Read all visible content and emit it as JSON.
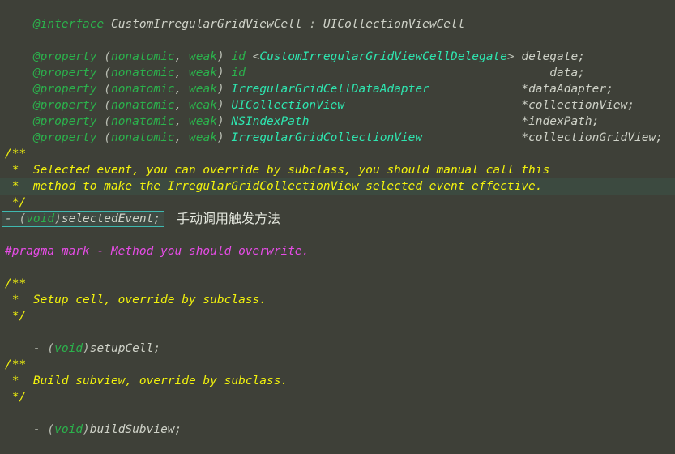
{
  "editor": {
    "background_color": "#3e4038",
    "highlight_band_color": "#3c4a40",
    "box_border_color": "#3fb9b0",
    "language": "Objective-C",
    "colors": {
      "keyword": "#2bb24c",
      "type": "#2ee6b0",
      "identifier": "#cfd2c8",
      "comment": "#f2f20d",
      "pragma": "#e64ce6",
      "punctuation": "#b9bdb2"
    }
  },
  "code": {
    "interface": {
      "keyword": "@interface",
      "class_name": " CustomIrregularGridViewCell",
      "separator": " : ",
      "superclass": "UICollectionViewCell"
    },
    "properties": [
      {
        "keyword": "@property",
        "open_paren": " (",
        "attribute_nonatomic": "nonatomic",
        "attribute_sep": ", ",
        "attribute_weak": "weak",
        "close_paren": ") ",
        "type_keyword": "id",
        "protocol_open": " <",
        "protocol": "CustomIrregularGridViewCellDelegate",
        "protocol_close": ">",
        "spacer": " ",
        "variable": "delegate;"
      },
      {
        "keyword": "@property",
        "open_paren": " (",
        "attribute_nonatomic": "nonatomic",
        "attribute_sep": ", ",
        "attribute_weak": "weak",
        "close_paren": ") ",
        "type_keyword": "id",
        "protocol_open": "",
        "protocol": "",
        "protocol_close": "",
        "spacer": "                                          ",
        "variable": " data;"
      },
      {
        "keyword": "@property",
        "open_paren": " (",
        "attribute_nonatomic": "nonatomic",
        "attribute_sep": ", ",
        "attribute_weak": "weak",
        "close_paren": ") ",
        "type_keyword": "",
        "protocol_open": "",
        "protocol": "IrregularGridCellDataAdapter",
        "protocol_close": "",
        "spacer": "             ",
        "variable": "*dataAdapter;"
      },
      {
        "keyword": "@property",
        "open_paren": " (",
        "attribute_nonatomic": "nonatomic",
        "attribute_sep": ", ",
        "attribute_weak": "weak",
        "close_paren": ") ",
        "type_keyword": "",
        "protocol_open": "",
        "protocol": "UICollectionView",
        "protocol_close": "",
        "spacer": "                         ",
        "variable": "*collectionView;"
      },
      {
        "keyword": "@property",
        "open_paren": " (",
        "attribute_nonatomic": "nonatomic",
        "attribute_sep": ", ",
        "attribute_weak": "weak",
        "close_paren": ") ",
        "type_keyword": "",
        "protocol_open": "",
        "protocol": "NSIndexPath",
        "protocol_close": "",
        "spacer": "                              ",
        "variable": "*indexPath;"
      },
      {
        "keyword": "@property",
        "open_paren": " (",
        "attribute_nonatomic": "nonatomic",
        "attribute_sep": ", ",
        "attribute_weak": "weak",
        "close_paren": ") ",
        "type_keyword": "",
        "protocol_open": "",
        "protocol": "IrregularGridCollectionView",
        "protocol_close": "",
        "spacer": "              ",
        "variable": "*collectionGridView;"
      }
    ],
    "selected_event_doc": {
      "open": "/**",
      "line1": " *  Selected event, you can override by subclass, you should manual call this",
      "line2": " *  method to make the IrregularGridCollectionView selected event effective.",
      "close": " */"
    },
    "selected_event_decl": {
      "dash": "- ",
      "paren_open": "(",
      "void_keyword": "void",
      "paren_close": ")",
      "method_name": "selectedEvent;"
    },
    "selected_event_annotation": "手动调用触发方法",
    "pragma_mark": "#pragma mark - Method you should overwrite.",
    "setup_cell_doc": {
      "open": "/**",
      "line1": " *  Setup cell, override by subclass.",
      "close": " */"
    },
    "setup_cell_decl": {
      "dash": "- ",
      "paren_open": "(",
      "void_keyword": "void",
      "paren_close": ")",
      "method_name": "setupCell;"
    },
    "build_subview_doc": {
      "open": "/**",
      "line1": " *  Build subview, override by subclass.",
      "close": " */"
    },
    "build_subview_decl": {
      "dash": "- ",
      "paren_open": "(",
      "void_keyword": "void",
      "paren_close": ")",
      "method_name": "buildSubview;"
    }
  }
}
